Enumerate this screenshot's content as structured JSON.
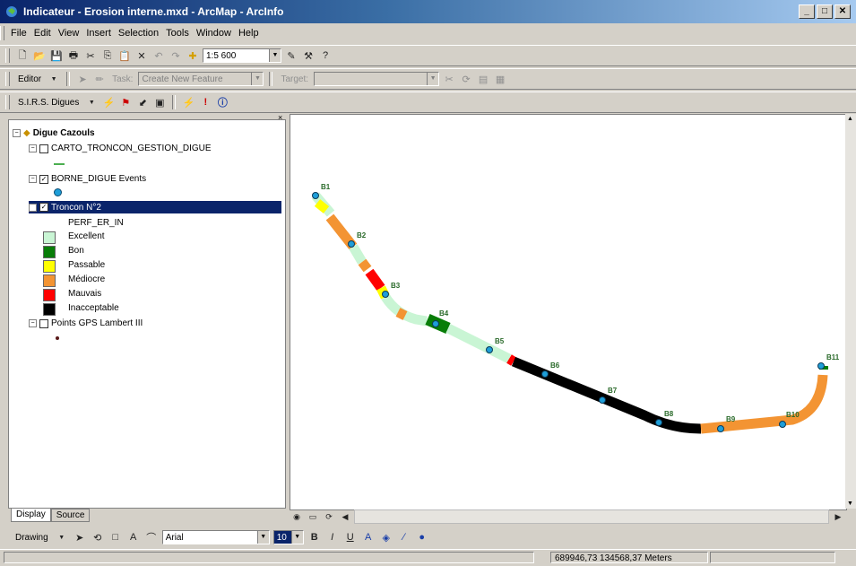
{
  "window": {
    "title": "Indicateur - Erosion interne.mxd - ArcMap - ArcInfo",
    "controls": [
      "_",
      "□",
      "✕"
    ]
  },
  "menu": [
    "File",
    "Edit",
    "View",
    "Insert",
    "Selection",
    "Tools",
    "Window",
    "Help"
  ],
  "standard_toolbar": {
    "scale_value": "1:5 600"
  },
  "editor_toolbar": {
    "editor_label": "Editor",
    "task_label": "Task:",
    "task_value": "Create New Feature",
    "target_label": "Target:",
    "target_value": ""
  },
  "sirs_toolbar": {
    "label": "S.I.R.S. Digues"
  },
  "toc": {
    "root": "Digue Cazouls",
    "layers": [
      {
        "name": "CARTO_TRONCON_GESTION_DIGUE",
        "checked": false
      },
      {
        "name": "BORNE_DIGUE Events",
        "checked": true
      },
      {
        "name": "Troncon N°2",
        "checked": true,
        "selected": true
      },
      {
        "name": "Points GPS Lambert III",
        "checked": false
      }
    ],
    "field": "PERF_ER_IN",
    "classes": [
      {
        "label": "Excellent",
        "color": "#c9f5d4"
      },
      {
        "label": "Bon",
        "color": "#087d08"
      },
      {
        "label": "Passable",
        "color": "#ffff00"
      },
      {
        "label": "Médiocre",
        "color": "#f39433"
      },
      {
        "label": "Mauvais",
        "color": "#ff0000"
      },
      {
        "label": "Inacceptable",
        "color": "#000000"
      }
    ]
  },
  "tabs": [
    "Display",
    "Source"
  ],
  "markers": [
    "B1",
    "B2",
    "B3",
    "B4",
    "B5",
    "B6",
    "B7",
    "B8",
    "B9",
    "B10",
    "B11"
  ],
  "drawing_toolbar": {
    "label": "Drawing",
    "font": "Arial",
    "size": "10"
  },
  "status": {
    "coords": "689946,73  134568,37 Meters"
  }
}
